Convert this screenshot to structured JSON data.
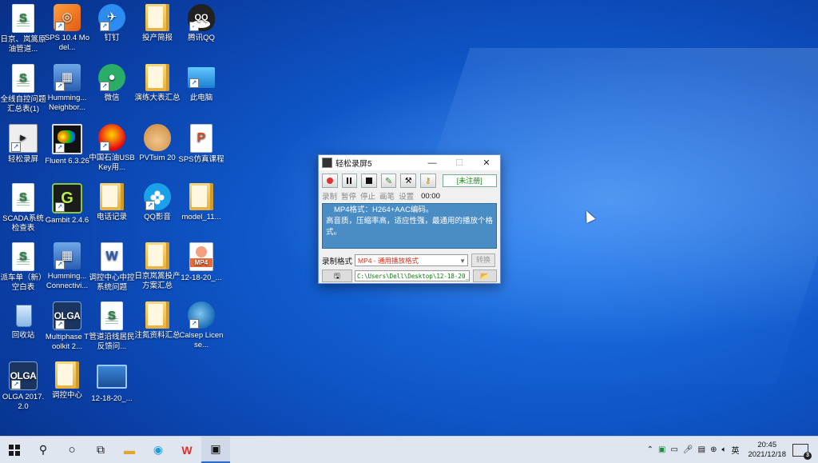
{
  "desktop": {
    "icons": [
      {
        "label": "日京、岚篙原油管道...",
        "icon": "excel-file-icon",
        "glyph": "S"
      },
      {
        "label": "SPS 10.4 Model...",
        "icon": "sps-app-icon",
        "glyph": "◎"
      },
      {
        "label": "钉钉",
        "icon": "dingtalk-icon",
        "glyph": "✈"
      },
      {
        "label": "投产简报",
        "icon": "folder-icon",
        "glyph": ""
      },
      {
        "label": "腾讯QQ",
        "icon": "qq-icon",
        "glyph": "QQ"
      },
      {
        "label": "全线自控问题汇总表(1)",
        "icon": "excel-file-icon",
        "glyph": "S"
      },
      {
        "label": "Humming... Neighbor...",
        "icon": "hummingbird-icon",
        "glyph": "▦"
      },
      {
        "label": "微信",
        "icon": "wechat-icon",
        "glyph": "●"
      },
      {
        "label": "演练大表汇总",
        "icon": "folder-icon",
        "glyph": ""
      },
      {
        "label": "此电脑",
        "icon": "this-pc-icon",
        "glyph": ""
      },
      {
        "label": "轻松录屏",
        "icon": "screen-recorder-icon",
        "glyph": "▶"
      },
      {
        "label": "Fluent 6.3.26",
        "icon": "fluent-icon",
        "glyph": ""
      },
      {
        "label": "中国石油USBKey用...",
        "icon": "petrochina-icon",
        "glyph": ""
      },
      {
        "label": "PVTsim 20",
        "icon": "pvtsim-icon",
        "glyph": ""
      },
      {
        "label": "SPS仿真课程",
        "icon": "pdf-file-icon",
        "glyph": "P"
      },
      {
        "label": "SCADA系统检查表",
        "icon": "excel-file-icon",
        "glyph": "S"
      },
      {
        "label": "Gambit 2.4.6",
        "icon": "gambit-icon",
        "glyph": "G"
      },
      {
        "label": "电话记录",
        "icon": "folder-icon",
        "glyph": ""
      },
      {
        "label": "QQ影音",
        "icon": "qq-video-icon",
        "glyph": ""
      },
      {
        "label": "model_11...",
        "icon": "folder-icon",
        "glyph": ""
      },
      {
        "label": "派车单（新）空白表",
        "icon": "excel-file-icon",
        "glyph": "S"
      },
      {
        "label": "Humming... Connectivi...",
        "icon": "hummingbird-icon",
        "glyph": "▦"
      },
      {
        "label": "调控中心中控系统问题",
        "icon": "word-file-icon",
        "glyph": "W"
      },
      {
        "label": "日京岚篙投产方案汇总",
        "icon": "folder-icon",
        "glyph": ""
      },
      {
        "label": "12-18-20_...",
        "icon": "mp4-file-icon",
        "glyph": "MP4"
      },
      {
        "label": "回收站",
        "icon": "recycle-bin-icon",
        "glyph": ""
      },
      {
        "label": "Multiphase Toolkit 2...",
        "icon": "olga-icon",
        "glyph": "OLGA"
      },
      {
        "label": "管道沿线居民反馈问...",
        "icon": "excel-file-icon",
        "glyph": "S"
      },
      {
        "label": "注氮资料汇总",
        "icon": "folder-icon",
        "glyph": ""
      },
      {
        "label": "Calsep License...",
        "icon": "calsep-icon",
        "glyph": ""
      },
      {
        "label": "OLGA 2017.2.0",
        "icon": "olga-icon",
        "glyph": "OLGA"
      },
      {
        "label": "调控中心",
        "icon": "folder-icon",
        "glyph": ""
      },
      {
        "label": "12-18-20_...",
        "icon": "video-file-icon",
        "glyph": ""
      }
    ]
  },
  "recorder": {
    "title": "轻松录屏5",
    "min": "—",
    "max": "☐",
    "close": "✕",
    "unregistered": "[未注册]",
    "labels": [
      "录制",
      "暂停",
      "停止",
      "画笔",
      "设置"
    ],
    "time": "00:00",
    "info_line1": "MP4格式：H264+AAC编码。",
    "info_line2": "高音质，压缩率高，适应性强，最通用的播放个格式。",
    "format_label": "录制格式",
    "format_value": "MP4 - 通用播放格式",
    "convert_label": "转换",
    "path_value": "C:\\Users\\Dell\\Desktop\\12-18-20_4"
  },
  "taskbar": {
    "time": "20:45",
    "date": "2021/12/18",
    "ime": "英",
    "notif_count": "3"
  },
  "colors": {
    "accent": "#2d6cd8",
    "desktop": "#0f56c8",
    "info_panel": "#4a8cc4"
  }
}
